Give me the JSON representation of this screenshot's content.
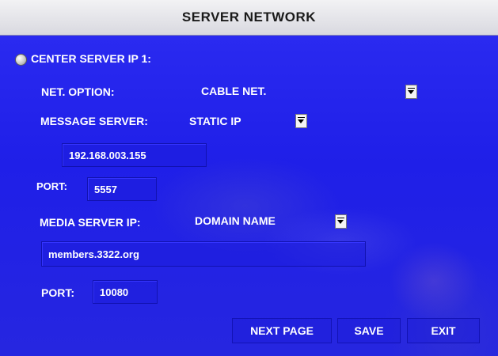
{
  "window": {
    "title": "SERVER NETWORK"
  },
  "center_server": {
    "label": "CENTER SERVER IP 1:"
  },
  "net_option": {
    "label": "NET. OPTION:",
    "value": "CABLE NET."
  },
  "message_server": {
    "label": "MESSAGE SERVER:",
    "value": "STATIC IP",
    "ip": "192.168.003.155"
  },
  "port1": {
    "label": "PORT:",
    "value": "5557"
  },
  "media_server": {
    "label": "MEDIA SERVER IP:",
    "value": "DOMAIN NAME",
    "domain": "members.3322.org"
  },
  "port2": {
    "label": "PORT:",
    "value": "10080"
  },
  "buttons": {
    "next": "NEXT PAGE",
    "save": "SAVE",
    "exit": "EXIT"
  },
  "colors": {
    "panel": "#1919e6",
    "title_bg": "#e6e6ea",
    "text": "#ffffff"
  }
}
